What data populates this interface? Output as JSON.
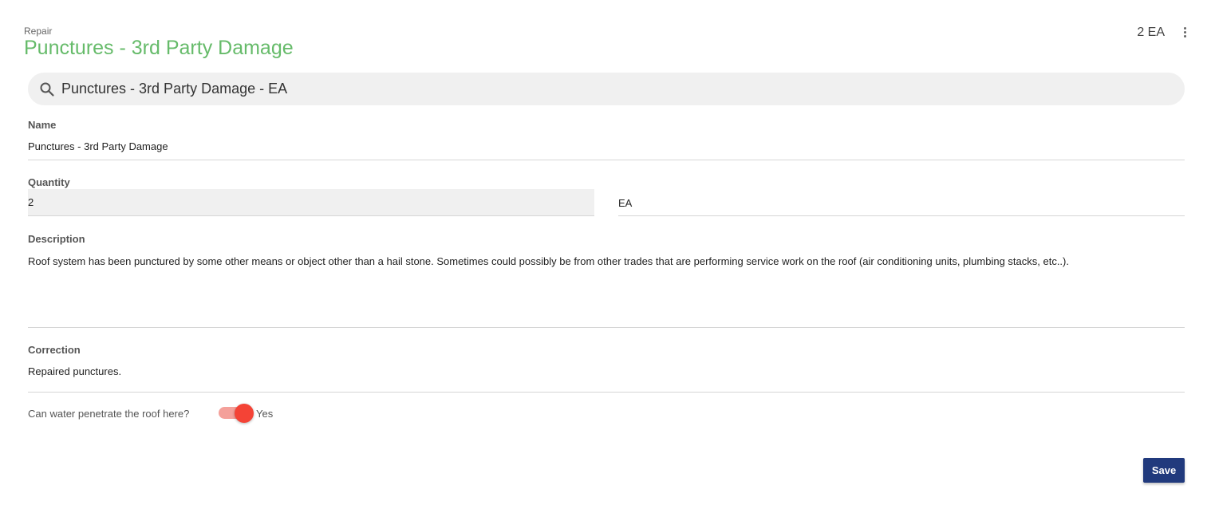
{
  "header": {
    "category": "Repair",
    "title": "Punctures - 3rd Party Damage",
    "quantity_display": "2 EA"
  },
  "search": {
    "value": "Punctures - 3rd Party Damage - EA",
    "icon": "search-icon"
  },
  "form": {
    "name": {
      "label": "Name",
      "value": "Punctures - 3rd Party Damage"
    },
    "quantity": {
      "label": "Quantity",
      "value": "2",
      "unit": "EA"
    },
    "description": {
      "label": "Description",
      "value": "Roof system has been punctured by some other means or object other than a hail stone. Sometimes could possibly be from other trades that are performing service work on the roof (air conditioning units, plumbing stacks, etc..)."
    },
    "correction": {
      "label": "Correction",
      "value": "Repaired punctures."
    },
    "water_penetration": {
      "label": "Can water penetrate the roof here?",
      "state_label": "Yes",
      "checked": true
    }
  },
  "actions": {
    "save_label": "Save"
  },
  "colors": {
    "title": "#66bb6a",
    "toggle_on": "#f44336",
    "save_button": "#213a7d"
  }
}
